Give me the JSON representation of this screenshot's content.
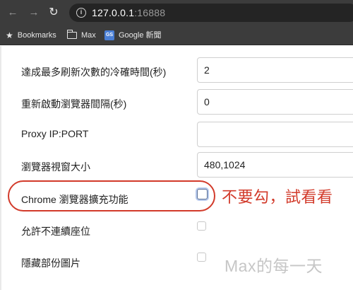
{
  "browser": {
    "url_host": "127.0.0.1",
    "url_port": ":16888",
    "bookmarks": [
      {
        "label": "Bookmarks",
        "icon": "star-icon"
      },
      {
        "label": "Max",
        "icon": "folder-icon"
      },
      {
        "label": "Google 新聞",
        "icon": "google-news-icon",
        "icon_text": "GS"
      }
    ]
  },
  "settings": {
    "rows": [
      {
        "label": "達成最多刷新次數的冷確時間(秒)",
        "value": "2"
      },
      {
        "label": "重新啟動瀏覽器間隔(秒)",
        "value": "0"
      },
      {
        "label": "Proxy IP:PORT",
        "value": ""
      },
      {
        "label": "瀏覽器視窗大小",
        "value": "480,1024"
      },
      {
        "label": "Chrome 瀏覽器擴充功能",
        "checked": false
      },
      {
        "label": "允許不連續座位",
        "checked": false
      },
      {
        "label": "隱藏部份圖片",
        "checked": false
      }
    ]
  },
  "annotation": {
    "text": "不要勾，試看看",
    "color": "#d23a2a"
  },
  "watermark": {
    "text": "Max的每一天"
  }
}
